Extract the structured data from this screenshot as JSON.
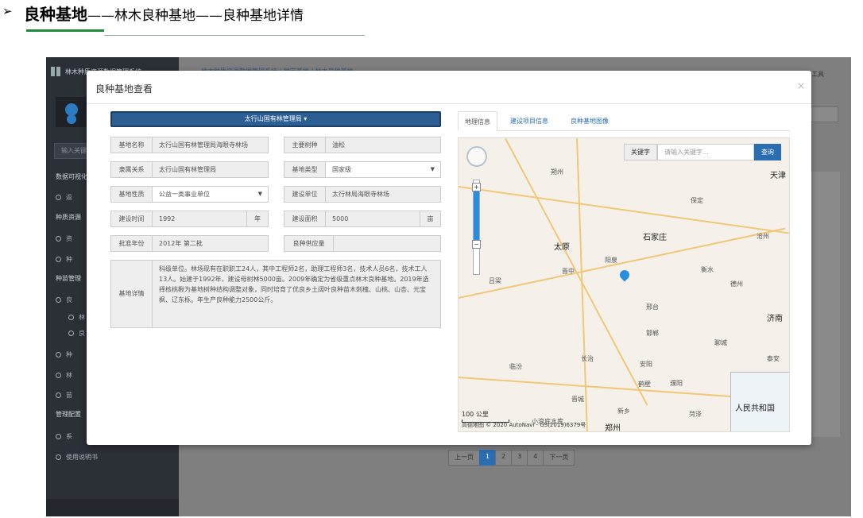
{
  "doc": {
    "arrow": "➢",
    "title_bold": "良种基地",
    "title_rest": "——林木良种基地——良种基地详情"
  },
  "sidebar": {
    "app_title": "林木种质资源数据管理系统",
    "search_placeholder": "输入关键",
    "sections": [
      "数据可视化",
      "种质资源",
      "种苗管理",
      "管理配置"
    ],
    "items": [
      "返",
      "资",
      "种",
      "良",
      "林",
      "良",
      "种",
      "林",
      "苗",
      "系",
      "使用说明书"
    ]
  },
  "main": {
    "breadcrumb": "林木种质资源数据管理系统 / 种苗基地 / 林木良种基地",
    "tools": "常用工具",
    "pager": [
      "上一页",
      "1",
      "2",
      "3",
      "4",
      "下一页"
    ]
  },
  "modal": {
    "title": "良种基地查看",
    "close": "×",
    "bureau_dropdown": "太行山国有林管理局",
    "fields": {
      "name_label": "基地名称",
      "name_value": "太行山国有林管理局海眼寺林场",
      "tree_label": "主要树种",
      "tree_value": "油松",
      "belong_label": "隶属关系",
      "belong_value": "太行山国有林管理局",
      "type_label": "基地类型",
      "type_value": "国家级",
      "nature_label": "基地性质",
      "nature_value": "公益一类事业单位",
      "builder_label": "建设单位",
      "builder_value": "太行林局海眼寺林场",
      "time_label": "建设时间",
      "time_value": "1992",
      "time_unit": "年",
      "area_label": "建设面积",
      "area_value": "5000",
      "area_unit": "亩",
      "approve_label": "批准年份",
      "approve_value": "2012年 第二批",
      "supply_label": "良种供应量",
      "supply_value": "",
      "detail_label": "基地详情",
      "detail_value": "科级单位。林场现有在职职工24人，其中工程师2名，助理工程师3名，技术人员6名，技术工人13人。始建于1992年，建设母树林5000亩。2009年确定为省级重点林木良种基地。2019年选择核桃楸为基地树种结构调整对象，同时培育了优良乡土阔叶良种苗木刺槐、山桃、山杏、元宝枫、辽东栎。年生产良种能力2500公斤。"
    },
    "tabs": [
      "地理信息",
      "建设项目信息",
      "良种基地图像"
    ],
    "map": {
      "keyword_label": "关键字",
      "keyword_placeholder": "请输入关键字...",
      "search_button": "查询",
      "cities_big": [
        "太原",
        "石家庄",
        "济南",
        "天津"
      ],
      "cities": [
        "朔州",
        "保定",
        "沧州",
        "阳泉",
        "晋中",
        "衡水",
        "德州",
        "吕梁",
        "邢台",
        "邯郸",
        "聊城",
        "泰安",
        "长治",
        "安阳",
        "临汾",
        "鹤壁",
        "濮阳",
        "晋城",
        "新乡",
        "菏泽",
        "郑州",
        "小浪底水库"
      ],
      "scale": "100 公里",
      "copyright": "高德地图 © 2020 AutoNavi - GS(2019)6379号",
      "inset_label": "人民共和国"
    }
  }
}
